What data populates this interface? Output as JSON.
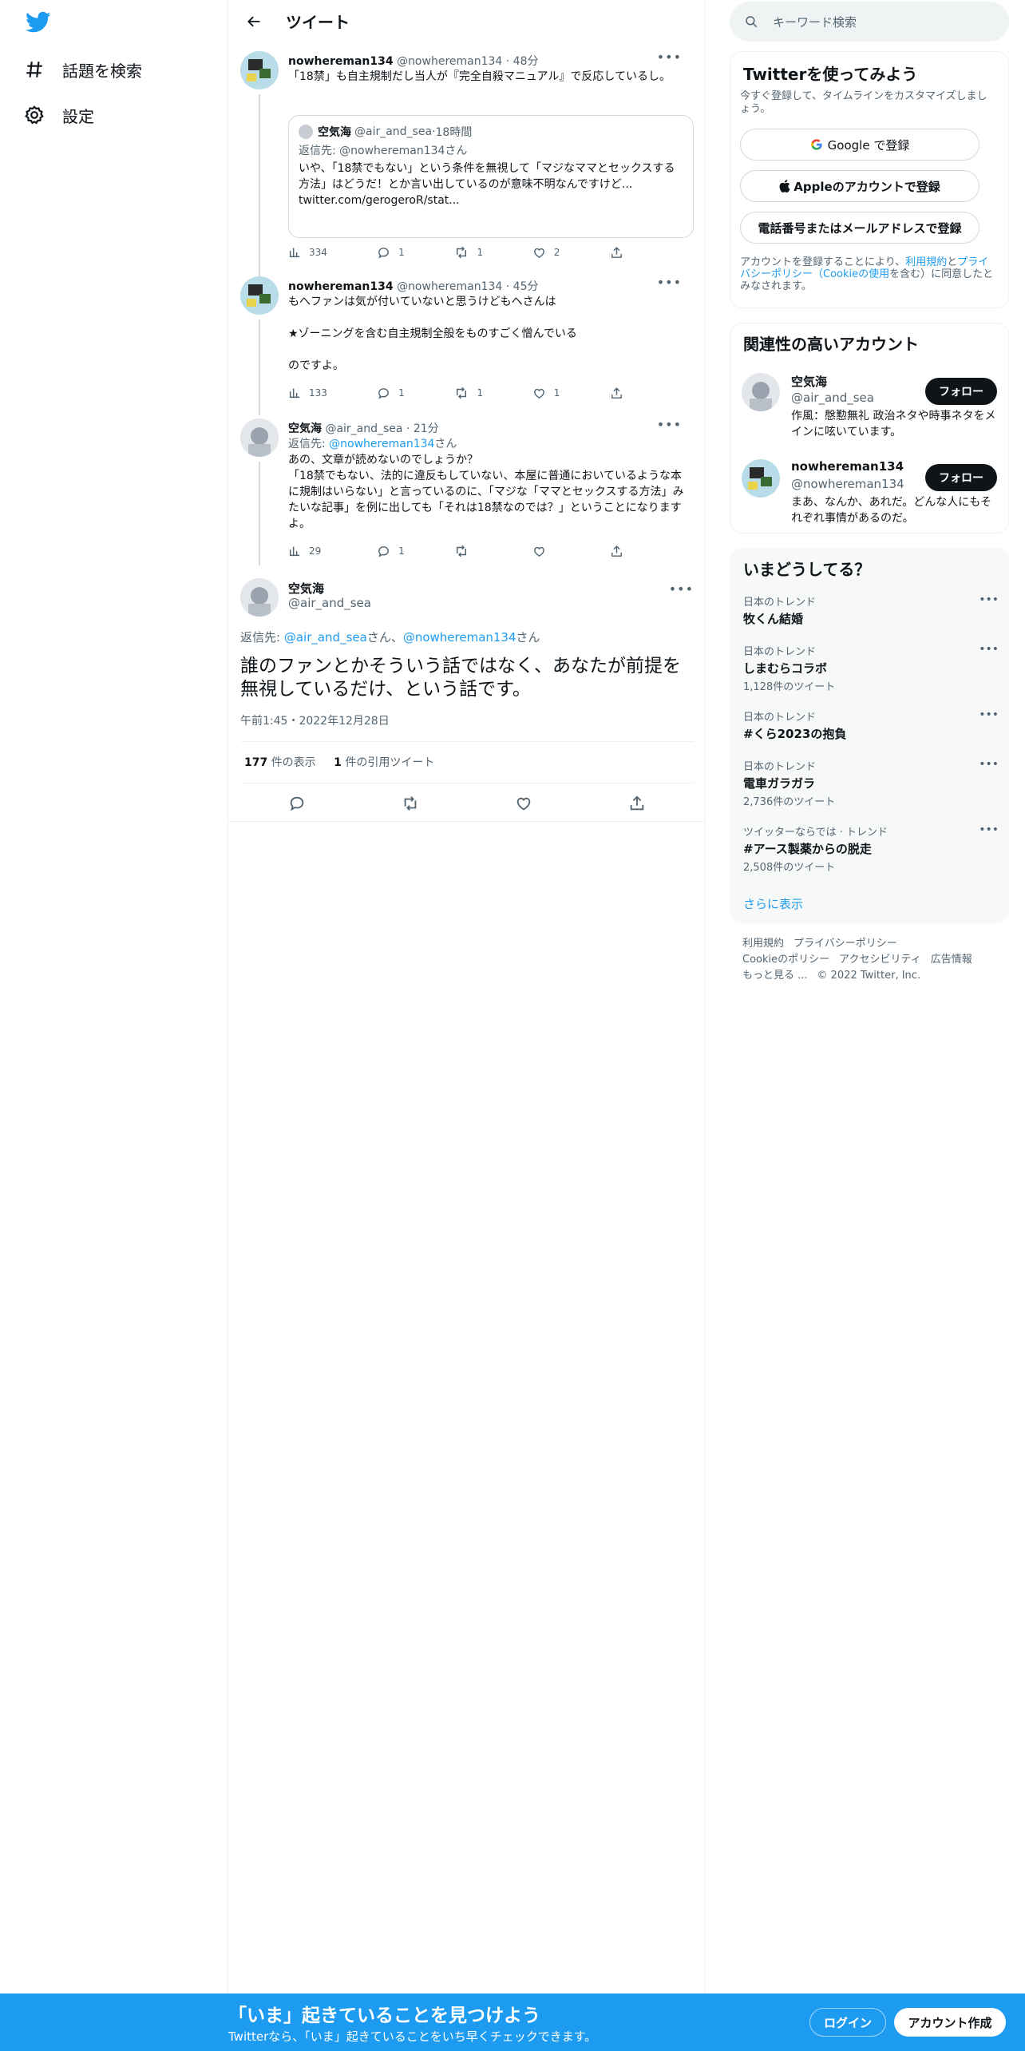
{
  "nav": {
    "explore": "話題を検索",
    "settings": "設定"
  },
  "header": {
    "title": "ツイート"
  },
  "tweets": [
    {
      "name": "nowhereman134",
      "handle": "@nowhereman134",
      "time": "48分",
      "text": "「18禁」も自主規制だし当人が『完全自殺マニュアル』で反応しているし。",
      "views": "334",
      "replies": "1",
      "retweets": "1",
      "likes": "2",
      "quote": {
        "name": "空気海",
        "handle": "@air_and_sea",
        "time": "18時間",
        "reply_to_label": "返信先: ",
        "reply_to_user": "@nowhereman134",
        "reply_to_suffix": "さん",
        "text": "いや、「18禁でもない」という条件を無視して「マジなママとセックスする方法」はどうだ！とか言い出しているのが意味不明なんですけど...",
        "link": "twitter.com/gerogeroR/stat..."
      }
    },
    {
      "name": "nowhereman134",
      "handle": "@nowhereman134",
      "time": "45分",
      "line1": "もへファンは気が付いていないと思うけどもへさんは",
      "line2": "★ゾーニングを含む自主規制全般をものすごく憎んでいる",
      "line3": "のですよ。",
      "views": "133",
      "replies": "1",
      "retweets": "1",
      "likes": "1"
    },
    {
      "name": "空気海",
      "handle": "@air_and_sea",
      "time": "21分",
      "reply_to_label": "返信先: ",
      "reply_to_user": "@nowhereman134",
      "reply_to_suffix": "さん",
      "text": "あの、文章が読めないのでしょうか？\n「18禁でもない、法的に違反もしていない、本屋に普通においているような本に規制はいらない」と言っているのに、「マジな「ママとセックスする方法」みたいな記事」を例に出しても「それは18禁なのでは？」ということになりますよ。",
      "views": "29",
      "replies": "1"
    }
  ],
  "main_tweet": {
    "name": "空気海",
    "handle": "@air_and_sea",
    "reply_to_label": "返信先: ",
    "reply_user1": "@air_and_sea",
    "reply_mid": "さん、",
    "reply_user2": "@nowhereman134",
    "reply_suffix": "さん",
    "text": "誰のファンとかそういう話ではなく、あなたが前提を無視しているだけ、という話です。",
    "timestamp": "午前1:45・2022年12月28日",
    "views_count": "177",
    "views_label": "件の表示",
    "quotes_count": "1",
    "quotes_label": "件の引用ツイート"
  },
  "search": {
    "placeholder": "キーワード検索"
  },
  "signup": {
    "title": "Twitterを使ってみよう",
    "subtitle": "今すぐ登録して、タイムラインをカスタマイズしましょう。",
    "google": "Google で登録",
    "apple": "Appleのアカウントで登録",
    "phone": "電話番号またはメールアドレスで登録",
    "legal_prefix": "アカウントを登録することにより、",
    "legal_terms": "利用規約",
    "legal_and": "と",
    "legal_privacy": "プライバシーポリシー",
    "legal_cookie": "（Cookieの使用",
    "legal_suffix": "を含む）に同意したとみなされます。"
  },
  "related": {
    "title": "関連性の高いアカウント",
    "accounts": [
      {
        "name": "空気海",
        "handle": "@air_and_sea",
        "bio": "作風：慇懃無礼 政治ネタや時事ネタをメインに呟いています。",
        "follow": "フォロー"
      },
      {
        "name": "nowhereman134",
        "handle": "@nowhereman134",
        "bio": "まあ、なんか、あれだ。どんな人にもそれぞれ事情があるのだ。",
        "follow": "フォロー"
      }
    ]
  },
  "trends": {
    "title": "いまどうしてる？",
    "items": [
      {
        "context": "日本のトレンド",
        "name": "牧くん結婚",
        "count": ""
      },
      {
        "context": "日本のトレンド",
        "name": "しまむらコラボ",
        "count": "1,128件のツイート"
      },
      {
        "context": "日本のトレンド",
        "name": "#くら2023の抱負",
        "count": ""
      },
      {
        "context": "日本のトレンド",
        "name": "電車ガラガラ",
        "count": "2,736件のツイート"
      },
      {
        "context": "ツイッターならでは · トレンド",
        "name": "#アース製薬からの脱走",
        "count": "2,508件のツイート"
      }
    ],
    "show_more": "さらに表示"
  },
  "footer": {
    "terms": "利用規約",
    "privacy": "プライバシーポリシー",
    "cookie": "Cookieのポリシー",
    "accessibility": "アクセシビリティ",
    "ads": "広告情報",
    "more": "もっと見る ...",
    "copyright": "© 2022 Twitter, Inc."
  },
  "bottombar": {
    "headline": "「いま」起きていることを見つけよう",
    "subline": "Twitterなら、「いま」起きていることをいち早くチェックできます。",
    "login": "ログイン",
    "signup": "アカウント作成"
  },
  "colors": {
    "accent": "#1d9bf0",
    "text": "#0f1419",
    "muted": "#536471",
    "border": "#eff3f4"
  }
}
